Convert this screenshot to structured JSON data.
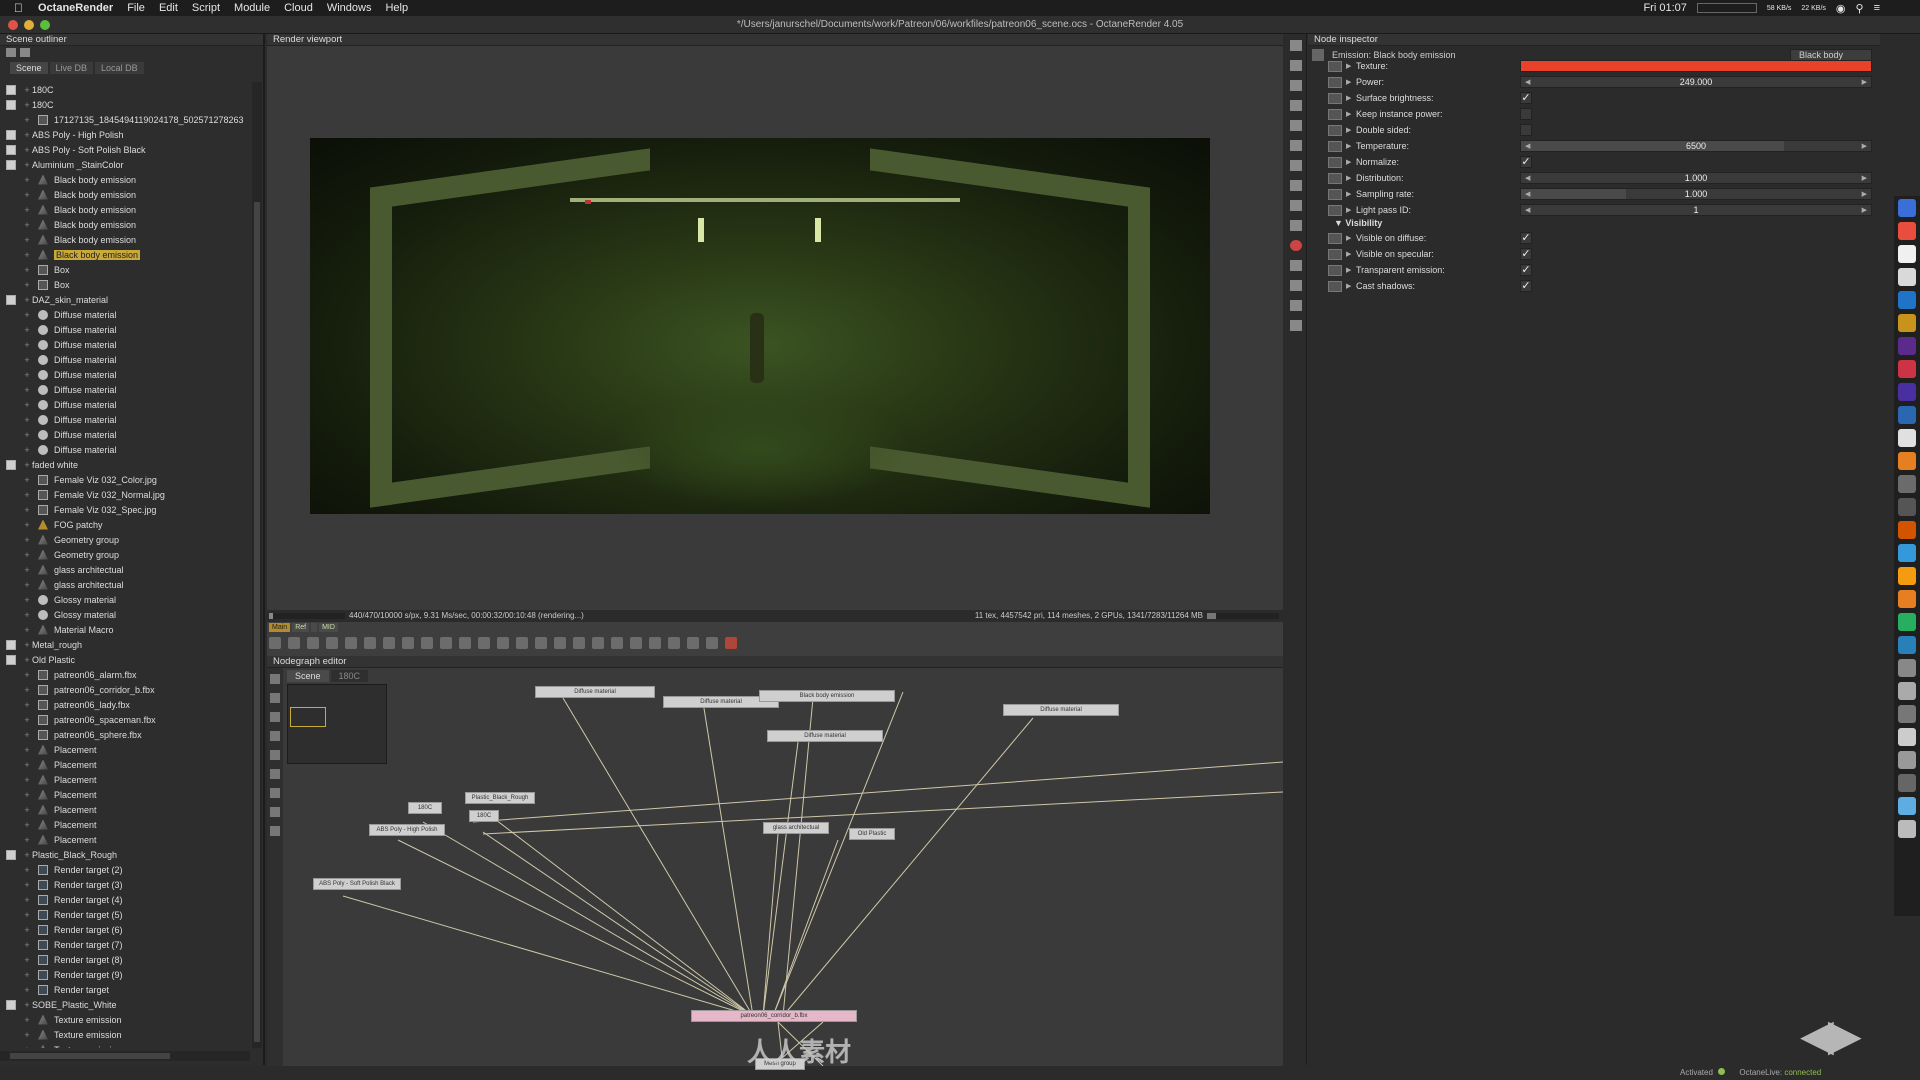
{
  "menubar": {
    "app": "OctaneRender",
    "items": [
      "File",
      "Edit",
      "Script",
      "Module",
      "Cloud",
      "Windows",
      "Help"
    ],
    "clock": "Fri 01:07",
    "net_up": "58 KB/s",
    "net_down": "22 KB/s"
  },
  "window_title": "*/Users/janurschel/Documents/work/Patreon/06/workfiles/patreon06_scene.ocs - OctaneRender 4.05",
  "outliner": {
    "title": "Scene outliner",
    "tabs": [
      "Scene",
      "Live DB",
      "Local DB"
    ],
    "items": [
      {
        "label": "180C",
        "icon": "node"
      },
      {
        "label": "180C",
        "icon": "node"
      },
      {
        "label": "17127135_1845494119024178_502571278263",
        "icon": "tex"
      },
      {
        "label": "ABS Poly - High Polish",
        "icon": "node"
      },
      {
        "label": "ABS Poly - Soft Polish Black",
        "icon": "node"
      },
      {
        "label": "Aluminium _StainColor",
        "icon": "node"
      },
      {
        "label": "Black body emission",
        "icon": "geo"
      },
      {
        "label": "Black body emission",
        "icon": "geo"
      },
      {
        "label": "Black body emission",
        "icon": "geo"
      },
      {
        "label": "Black body emission",
        "icon": "geo"
      },
      {
        "label": "Black body emission",
        "icon": "geo"
      },
      {
        "label": "Black body emission",
        "icon": "geo",
        "selected": true
      },
      {
        "label": "Box",
        "icon": "tex"
      },
      {
        "label": "Box",
        "icon": "tex"
      },
      {
        "label": "DAZ_skin_material",
        "icon": "node"
      },
      {
        "label": "Diffuse material",
        "icon": "mat"
      },
      {
        "label": "Diffuse material",
        "icon": "mat"
      },
      {
        "label": "Diffuse material",
        "icon": "mat"
      },
      {
        "label": "Diffuse material",
        "icon": "mat"
      },
      {
        "label": "Diffuse material",
        "icon": "mat"
      },
      {
        "label": "Diffuse material",
        "icon": "mat"
      },
      {
        "label": "Diffuse material",
        "icon": "mat"
      },
      {
        "label": "Diffuse material",
        "icon": "mat"
      },
      {
        "label": "Diffuse material",
        "icon": "mat"
      },
      {
        "label": "Diffuse material",
        "icon": "mat"
      },
      {
        "label": "faded white",
        "icon": "node"
      },
      {
        "label": "Female Viz 032_Color.jpg",
        "icon": "tex"
      },
      {
        "label": "Female Viz 032_Normal.jpg",
        "icon": "tex"
      },
      {
        "label": "Female Viz 032_Spec.jpg",
        "icon": "tex"
      },
      {
        "label": "FOG patchy",
        "icon": "fog"
      },
      {
        "label": "Geometry group",
        "icon": "geo"
      },
      {
        "label": "Geometry group",
        "icon": "geo"
      },
      {
        "label": "glass architectual",
        "icon": "geo"
      },
      {
        "label": "glass architectual",
        "icon": "geo"
      },
      {
        "label": "Glossy material",
        "icon": "mat"
      },
      {
        "label": "Glossy material",
        "icon": "mat"
      },
      {
        "label": "Material Macro",
        "icon": "geo"
      },
      {
        "label": "Metal_rough",
        "icon": "node"
      },
      {
        "label": "Old Plastic",
        "icon": "node"
      },
      {
        "label": "patreon06_alarm.fbx",
        "icon": "tex"
      },
      {
        "label": "patreon06_corridor_b.fbx",
        "icon": "tex"
      },
      {
        "label": "patreon06_lady.fbx",
        "icon": "tex"
      },
      {
        "label": "patreon06_spaceman.fbx",
        "icon": "tex"
      },
      {
        "label": "patreon06_sphere.fbx",
        "icon": "tex"
      },
      {
        "label": "Placement",
        "icon": "geo"
      },
      {
        "label": "Placement",
        "icon": "geo"
      },
      {
        "label": "Placement",
        "icon": "geo"
      },
      {
        "label": "Placement",
        "icon": "geo"
      },
      {
        "label": "Placement",
        "icon": "geo"
      },
      {
        "label": "Placement",
        "icon": "geo"
      },
      {
        "label": "Placement",
        "icon": "geo"
      },
      {
        "label": "Plastic_Black_Rough",
        "icon": "node"
      },
      {
        "label": "Render target (2)",
        "icon": "rt"
      },
      {
        "label": "Render target (3)",
        "icon": "rt"
      },
      {
        "label": "Render target (4)",
        "icon": "rt"
      },
      {
        "label": "Render target (5)",
        "icon": "rt"
      },
      {
        "label": "Render target (6)",
        "icon": "rt"
      },
      {
        "label": "Render target (7)",
        "icon": "rt"
      },
      {
        "label": "Render target (8)",
        "icon": "rt"
      },
      {
        "label": "Render target (9)",
        "icon": "rt"
      },
      {
        "label": "Render target",
        "icon": "rt"
      },
      {
        "label": "SOBE_Plastic_White",
        "icon": "node"
      },
      {
        "label": "Texture emission",
        "icon": "geo"
      },
      {
        "label": "Texture emission",
        "icon": "geo"
      },
      {
        "label": "Texture emission",
        "icon": "geo"
      }
    ]
  },
  "viewport": {
    "title": "Render viewport",
    "status_left": "440/470/10000 s/px, 9.31 Ms/sec, 00:00:32/00:10:48 (rendering...)",
    "status_right": "11 tex, 4457542 pri, 114 meshes, 2 GPUs, 1341/7283/11264 MB",
    "progress": 0.05,
    "gpu_memory": 0.12,
    "mini_tabs": [
      "Main",
      "Ref",
      "",
      "MID"
    ]
  },
  "nodegraph": {
    "title": "Nodegraph editor",
    "tabs": [
      "Scene",
      "180C"
    ],
    "nodes": [
      "Diffuse material",
      "Diffuse material",
      "Black body emission",
      "Diffuse material",
      "Diffuse material",
      "180C",
      "Plastic_Black_Rough",
      "180C",
      "ABS Poly - High Polish",
      "ABS Poly - Soft Polish Black",
      "glass architectual",
      "Old Plastic",
      "patreon06_corridor_b.fbx",
      "Mesh group"
    ],
    "watermark": "人人素材"
  },
  "inspector": {
    "title": "Node inspector",
    "node_name": "Emission: Black body emission",
    "node_type": "Black body",
    "params": [
      {
        "label": "Texture:",
        "kind": "color",
        "color": "#e8432a"
      },
      {
        "label": "Power:",
        "kind": "slider",
        "value": "249.000",
        "fill": 0.0
      },
      {
        "label": "Surface brightness:",
        "kind": "check",
        "checked": true
      },
      {
        "label": "Keep instance power:",
        "kind": "check",
        "checked": false
      },
      {
        "label": "Double sided:",
        "kind": "check",
        "checked": false
      },
      {
        "label": "Temperature:",
        "kind": "slider",
        "value": "6500",
        "fill": 0.75
      },
      {
        "label": "Normalize:",
        "kind": "check",
        "checked": true
      },
      {
        "label": "Distribution:",
        "kind": "slider",
        "value": "1.000",
        "fill": 0.0
      },
      {
        "label": "Sampling rate:",
        "kind": "slider",
        "value": "1.000",
        "fill": 0.3
      },
      {
        "label": "Light pass ID:",
        "kind": "slider",
        "value": "1",
        "fill": 0.0
      }
    ],
    "visibility_label": "Visibility",
    "visibility": [
      {
        "label": "Visible on diffuse:",
        "checked": true
      },
      {
        "label": "Visible on specular:",
        "checked": true
      },
      {
        "label": "Transparent emission:",
        "checked": true
      },
      {
        "label": "Cast shadows:",
        "checked": true
      }
    ]
  },
  "status": {
    "activated_label": "Activated",
    "octanelive_label": "OctaneLive:",
    "octanelive_value": "connected"
  }
}
